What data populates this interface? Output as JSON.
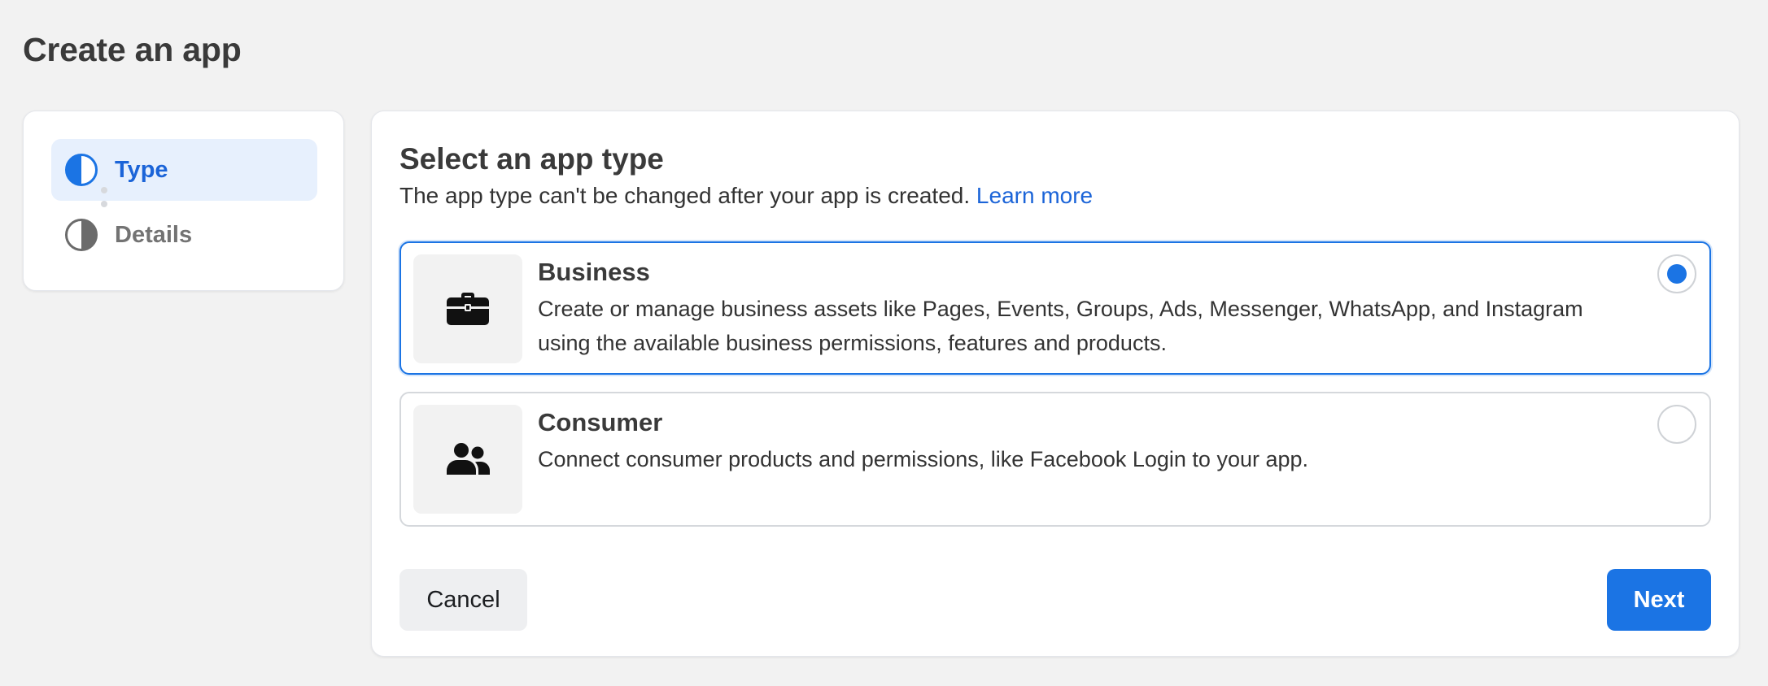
{
  "page": {
    "title": "Create an app"
  },
  "steps": [
    {
      "label": "Type",
      "icon": "half-circle-icon",
      "active": true
    },
    {
      "label": "Details",
      "icon": "half-circle-icon",
      "active": false
    }
  ],
  "main": {
    "title": "Select an app type",
    "subtitle": "The app type can't be changed after your app is created.",
    "learn_more": "Learn more",
    "options": [
      {
        "title": "Business",
        "description": "Create or manage business assets like Pages, Events, Groups, Ads, Messenger, WhatsApp, and Instagram using the available business permissions, features and products.",
        "icon": "briefcase-icon",
        "selected": true
      },
      {
        "title": "Consumer",
        "description": "Connect consumer products and permissions, like Facebook Login to your app.",
        "icon": "people-icon",
        "selected": false
      }
    ]
  },
  "buttons": {
    "cancel": "Cancel",
    "next": "Next"
  },
  "colors": {
    "accent": "#1b74e4",
    "link": "#1b64d8",
    "background": "#f2f2f2"
  }
}
